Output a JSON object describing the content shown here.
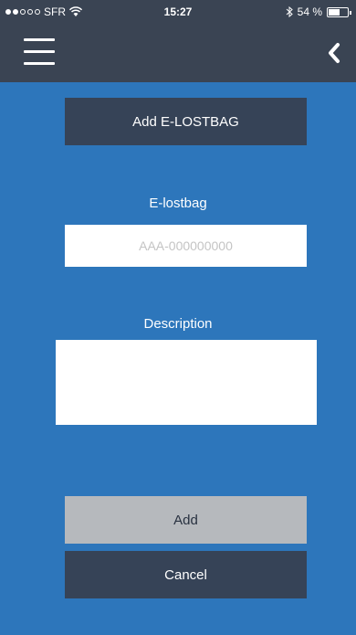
{
  "status_bar": {
    "carrier": "SFR",
    "time": "15:27",
    "battery": "54 %"
  },
  "nav": {
    "menu_icon": "hamburger-menu-icon",
    "back_icon": "chevron-left-icon"
  },
  "header_button": {
    "label": "Add E-LOSTBAG"
  },
  "elostbag": {
    "label": "E-lostbag",
    "value": "",
    "placeholder": "AAA-000000000"
  },
  "description": {
    "label": "Description",
    "value": ""
  },
  "actions": {
    "add_label": "Add",
    "cancel_label": "Cancel"
  },
  "colors": {
    "background": "#2d76bb",
    "nav": "#3a4453",
    "button_dark": "#364357",
    "button_disabled": "#b6b9bd"
  }
}
